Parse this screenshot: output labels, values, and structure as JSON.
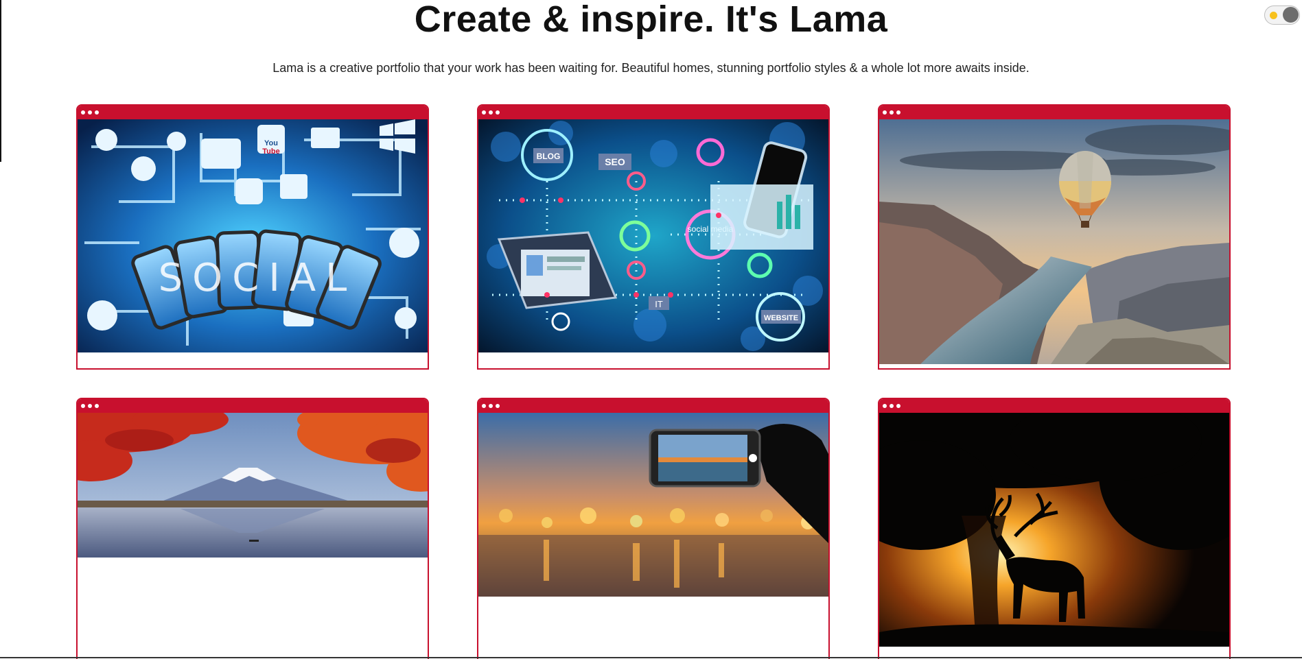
{
  "header": {
    "title": "Create & inspire. It's Lama",
    "subtitle": "Lama is a creative portfolio that your work has been waiting for. Beautiful homes, stunning portfolio styles & a whole lot more awaits inside."
  },
  "theme_toggle": {
    "icon": "sun-icon",
    "state": "light"
  },
  "colors": {
    "accent": "#c8102e",
    "toggle_sun": "#f7c11d",
    "toggle_knob": "#6d6d6d"
  },
  "projects": [
    {
      "image_icon": "social-media-phones-image",
      "image_text": [
        "SOCIAL",
        "You",
        "Tube"
      ]
    },
    {
      "image_icon": "digital-marketing-network-image",
      "image_text": [
        "BLOG",
        "SEO",
        "social media",
        "IT",
        "WEBSITE"
      ]
    },
    {
      "image_icon": "hot-air-balloon-canyon-image"
    },
    {
      "image_icon": "mount-fuji-autumn-image"
    },
    {
      "image_icon": "phone-photographing-sunset-image"
    },
    {
      "image_icon": "deer-silhouette-sunset-image"
    }
  ]
}
